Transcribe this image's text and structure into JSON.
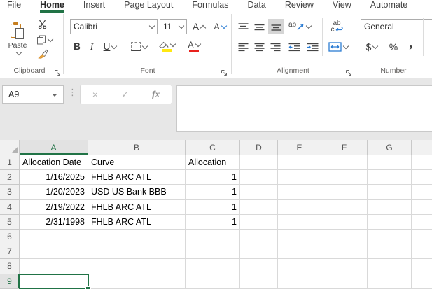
{
  "titlebar_tabs": {
    "items": [
      "File",
      "Home",
      "Insert",
      "Page Layout",
      "Formulas",
      "Data",
      "Review",
      "View",
      "Automate"
    ],
    "active": "Home"
  },
  "ribbon": {
    "clipboard": {
      "group_label": "Clipboard",
      "paste": "Paste"
    },
    "font": {
      "group_label": "Font",
      "family": "Calibri",
      "size": "11",
      "bold": "B",
      "italic": "I",
      "underline": "U",
      "grow": "A",
      "shrink": "A",
      "color_letter": "A"
    },
    "alignment": {
      "group_label": "Alignment",
      "orient_ab": "ab",
      "wrap_ab": "ab",
      "wrap_c": "c"
    },
    "number": {
      "group_label": "Number",
      "format": "General",
      "currency": "$",
      "percent": "%",
      "comma": ","
    }
  },
  "formula_bar": {
    "name_box": "A9",
    "cancel": "×",
    "enter": "✓",
    "fx": "fx",
    "value": ""
  },
  "sheet": {
    "selected_cell": "A9",
    "column_headers": [
      "A",
      "B",
      "C",
      "D",
      "E",
      "F",
      "G",
      ""
    ],
    "row_headers": [
      "1",
      "2",
      "3",
      "4",
      "5",
      "6",
      "7",
      "8",
      "9"
    ],
    "rows": [
      {
        "cells": [
          {
            "col": "A",
            "value": "Allocation Date",
            "align": "left"
          },
          {
            "col": "B",
            "value": "Curve",
            "align": "left"
          },
          {
            "col": "C",
            "value": "Allocation",
            "align": "left"
          }
        ]
      },
      {
        "cells": [
          {
            "col": "A",
            "value": "1/16/2025",
            "align": "right"
          },
          {
            "col": "B",
            "value": "FHLB ARC ATL",
            "align": "left"
          },
          {
            "col": "C",
            "value": "1",
            "align": "right"
          }
        ]
      },
      {
        "cells": [
          {
            "col": "A",
            "value": "1/20/2023",
            "align": "right"
          },
          {
            "col": "B",
            "value": "USD US Bank BBB",
            "align": "left"
          },
          {
            "col": "C",
            "value": "1",
            "align": "right"
          }
        ]
      },
      {
        "cells": [
          {
            "col": "A",
            "value": "2/19/2022",
            "align": "right"
          },
          {
            "col": "B",
            "value": "FHLB ARC ATL",
            "align": "left"
          },
          {
            "col": "C",
            "value": "1",
            "align": "right"
          }
        ]
      },
      {
        "cells": [
          {
            "col": "A",
            "value": "2/31/1998",
            "align": "right"
          },
          {
            "col": "B",
            "value": "FHLB ARC ATL",
            "align": "left"
          },
          {
            "col": "C",
            "value": "1",
            "align": "right"
          }
        ]
      }
    ]
  },
  "colors": {
    "accent_green": "#217346",
    "fill_yellow": "#FFE812",
    "font_red": "#E8221D",
    "icon_blue": "#2B7CD3",
    "paste_orange": "#C77F1F"
  }
}
